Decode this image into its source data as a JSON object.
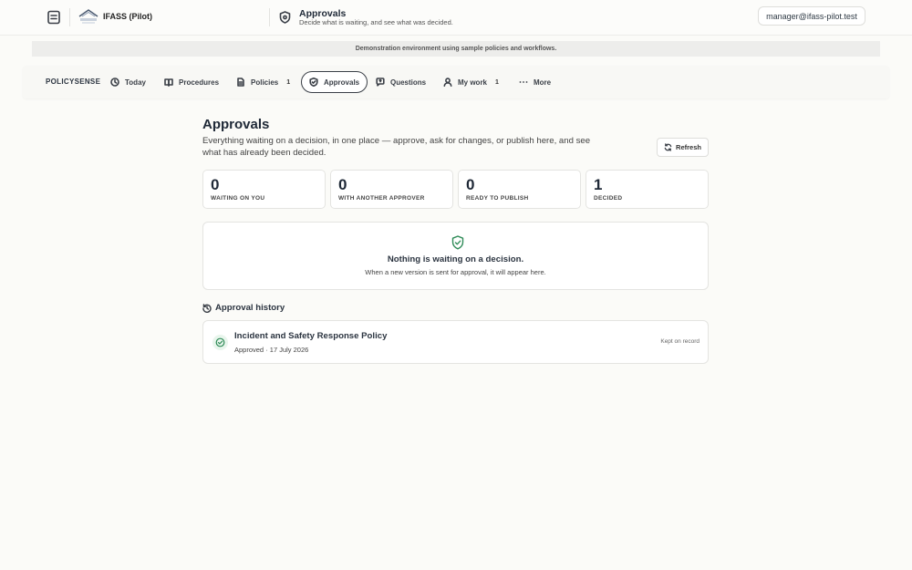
{
  "header": {
    "org_name": "IFASS (Pilot)",
    "context_title": "Approvals",
    "context_subtitle": "Decide what is waiting, and see what was decided.",
    "account": "manager@ifass-pilot.test"
  },
  "banner": "Demonstration environment using sample policies and workflows.",
  "nav": {
    "brand": "POLICYSENSE",
    "items": [
      {
        "label": "Today",
        "icon": "clock-icon"
      },
      {
        "label": "Procedures",
        "icon": "book-icon"
      },
      {
        "label": "Policies",
        "icon": "document-icon",
        "count": "1"
      },
      {
        "label": "Approvals",
        "icon": "shield-icon",
        "active": true
      },
      {
        "label": "Questions",
        "icon": "chat-icon"
      },
      {
        "label": "My work",
        "icon": "user-icon",
        "count": "1"
      },
      {
        "label": "More",
        "icon": "ellipsis-icon"
      }
    ]
  },
  "page": {
    "title": "Approvals",
    "description": "Everything waiting on a decision, in one place — approve, ask for changes, or publish here, and see what has already been decided.",
    "refresh_label": "Refresh"
  },
  "stats": [
    {
      "value": "0",
      "label": "WAITING ON YOU"
    },
    {
      "value": "0",
      "label": "WITH ANOTHER APPROVER"
    },
    {
      "value": "0",
      "label": "READY TO PUBLISH"
    },
    {
      "value": "1",
      "label": "DECIDED"
    }
  ],
  "empty_state": {
    "title": "Nothing is waiting on a decision.",
    "subtitle": "When a new version is sent for approval, it will appear here."
  },
  "history": {
    "title": "Approval history",
    "items": [
      {
        "name": "Incident and Safety Response Policy",
        "meta": "Approved · 17 July 2026",
        "status": "Kept on record"
      }
    ]
  },
  "colors": {
    "success": "#2e8b57",
    "border": "#e4e4e1",
    "text": "#1f2937"
  }
}
